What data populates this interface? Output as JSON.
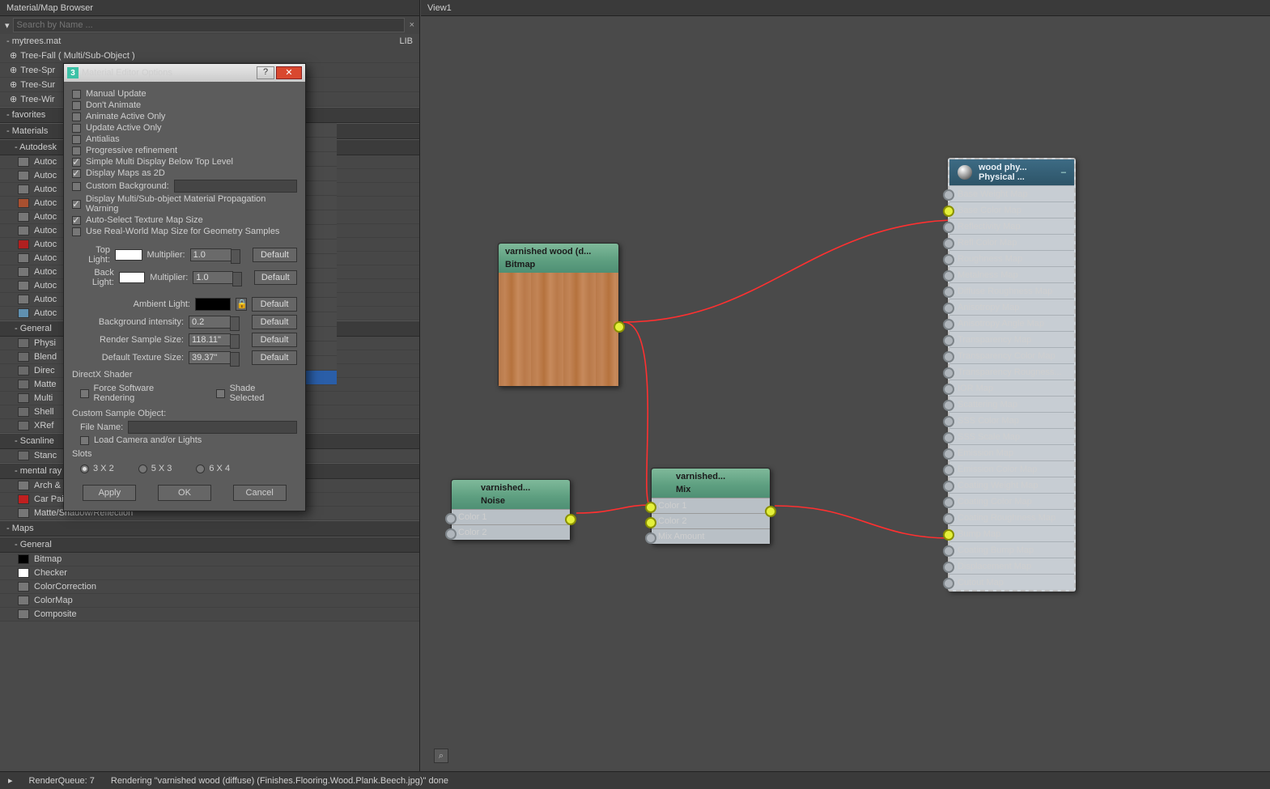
{
  "leftPanel": {
    "title": "Material/Map Browser",
    "search": {
      "placeholder": "Search by Name ..."
    },
    "library": {
      "name": "mytrees.mat",
      "tag": "LIB"
    },
    "treeItems": [
      "Tree-Fall  ( Multi/Sub-Object )",
      "Tree-Spr",
      "Tree-Sur",
      "Tree-Wir"
    ],
    "favoritesHeader": "favorites",
    "materialsHeader": "Materials",
    "autodeskHeader": "Autodesk",
    "autodeskItems": [
      "Autoc",
      "Autoc",
      "Autoc",
      "Autoc",
      "Autoc",
      "Autoc",
      "Autoc",
      "Autoc",
      "Autoc",
      "Autoc",
      "Autoc",
      "Autoc"
    ],
    "generalHeader": "General",
    "generalItems": [
      "Physi",
      "Blend",
      "Direc",
      "Matte",
      "Multi",
      "Shell",
      "XRef"
    ],
    "scanlineHeader": "Scanline",
    "scanlineItems": [
      "Stanc"
    ],
    "mentalRayHeader": "mental ray",
    "mentalRayItems": [
      "Arch & Design",
      "Car Paint",
      "Matte/Shadow/Reflection"
    ],
    "mapsHeader": "Maps",
    "mapsGeneralHeader": "General",
    "mapsItems": [
      "Bitmap",
      "Checker",
      "ColorCorrection",
      "ColorMap",
      "Composite"
    ]
  },
  "view": {
    "title": "View1"
  },
  "dialog": {
    "title": "Material Editor Options",
    "checks": [
      {
        "label": "Manual Update",
        "on": false
      },
      {
        "label": "Don't Animate",
        "on": false
      },
      {
        "label": "Animate Active Only",
        "on": false
      },
      {
        "label": "Update Active Only",
        "on": false
      },
      {
        "label": "Antialias",
        "on": false
      },
      {
        "label": "Progressive refinement",
        "on": false
      },
      {
        "label": "Simple Multi Display Below Top Level",
        "on": true
      },
      {
        "label": "Display Maps as 2D",
        "on": true
      }
    ],
    "customBgLabel": "Custom Background:",
    "extraChecks": [
      {
        "label": "Display Multi/Sub-object Material Propagation Warning",
        "on": true
      },
      {
        "label": "Auto-Select Texture Map Size",
        "on": true
      },
      {
        "label": "Use Real-World Map Size for Geometry Samples",
        "on": false,
        "disabled": true
      }
    ],
    "lightRows": {
      "topLight": "Top Light:",
      "backLight": "Back Light:",
      "multiplier": "Multiplier:",
      "multVal": "1.0",
      "default": "Default"
    },
    "ambientLabel": "Ambient Light:",
    "bgIntensity": {
      "label": "Background intensity:",
      "val": "0.2"
    },
    "renderSample": {
      "label": "Render Sample Size:",
      "val": "118.11\""
    },
    "defTexSize": {
      "label": "Default Texture Size:",
      "val": "39.37\""
    },
    "dxHeader": "DirectX Shader",
    "forceSW": "Force Software Rendering",
    "shadeSel": "Shade Selected",
    "customSample": "Custom Sample Object:",
    "fileName": "File Name:",
    "loadCam": "Load Camera and/or Lights",
    "slotsHeader": "Slots",
    "slotOpts": [
      "3 X 2",
      "5 X 3",
      "6 X 4"
    ],
    "apply": "Apply",
    "ok": "OK",
    "cancel": "Cancel"
  },
  "nodes": {
    "wood": {
      "title": "varnished wood (d...",
      "type": "Bitmap"
    },
    "noise": {
      "title": "varnished...",
      "type": "Noise",
      "slots": [
        "Color 1",
        "Color 2"
      ]
    },
    "mix": {
      "title": "varnished...",
      "type": "Mix",
      "slots": [
        "Color 1",
        "Color 2",
        "Mix Amount"
      ]
    },
    "phys": {
      "title": "wood phy...",
      "sub": "Physical ...",
      "slots": [
        "Base Weight Map",
        "Base Color Map",
        "Reflectivity Map",
        "Refl Color Map",
        "Roughness Map",
        "Metalness Map",
        "Diffuse Roughness Map",
        "Anisotropy Map",
        "Anisotropy Angle Map",
        "Transparency Map",
        "Transparency Color Map",
        "Transparency Rougness...",
        "IOR Map",
        "Scattering Map",
        "SSS Color Map",
        "SSS Scale Map",
        "Emission Map",
        "Emission Color Map",
        "Coating Weight Map",
        "Coating Color Map",
        "Coating Roughness Map",
        "Bump Map",
        "Coating Bump Map",
        "Displacement Map",
        "Cutout Map"
      ]
    }
  },
  "status": {
    "queue": "RenderQueue: 7",
    "msg": "Rendering \"varnished wood (diffuse) (Finishes.Flooring.Wood.Plank.Beech.jpg)\" done"
  }
}
